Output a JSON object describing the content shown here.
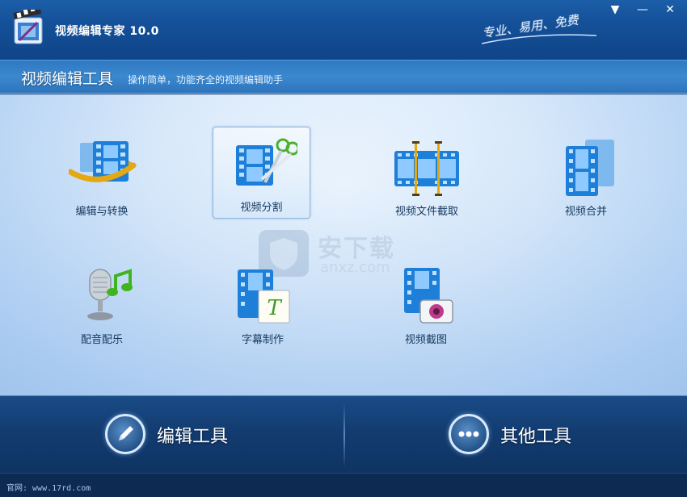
{
  "window": {
    "title": "视频编辑专家 10.0",
    "slogan": "专业、易用、免费",
    "controls": {
      "menu": "▼",
      "minimize": "—",
      "close": "✕"
    }
  },
  "header": {
    "section_title": "视频编辑工具",
    "subtitle": "操作简单，功能齐全的视频编辑助手"
  },
  "tools": [
    {
      "label": "编辑与转换",
      "icon": "film-convert-icon"
    },
    {
      "label": "视频分割",
      "icon": "film-scissors-icon",
      "selected": true
    },
    {
      "label": "视频文件截取",
      "icon": "film-trim-icon"
    },
    {
      "label": "视频合并",
      "icon": "film-merge-icon"
    },
    {
      "label": "配音配乐",
      "icon": "microphone-music-icon"
    },
    {
      "label": "字幕制作",
      "icon": "film-subtitle-icon"
    },
    {
      "label": "视频截图",
      "icon": "film-camera-icon"
    }
  ],
  "watermark": {
    "text": "安下载",
    "url": "anxz.com"
  },
  "bottom_nav": [
    {
      "label": "编辑工具",
      "icon": "pencil-icon",
      "active": true
    },
    {
      "label": "其他工具",
      "icon": "more-dots-icon",
      "active": false
    }
  ],
  "footer": {
    "text": "官网: www.17rd.com"
  },
  "colors": {
    "titlebar": "#145098",
    "header_band": "#3c89cf",
    "main_bg": "#dcebfb",
    "bottom_bar": "#123b6f",
    "label_text": "#16395f",
    "film_blue": "#1e7fd8"
  }
}
